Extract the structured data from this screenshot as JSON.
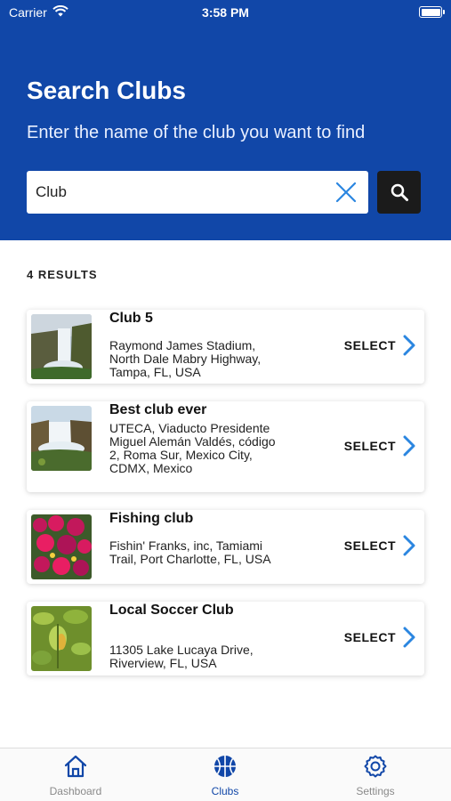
{
  "status": {
    "carrier": "Carrier",
    "time": "3:58 PM"
  },
  "header": {
    "title": "Search Clubs",
    "subtitle": "Enter the name of the club you want to find"
  },
  "search": {
    "value": "Club",
    "placeholder": ""
  },
  "results": {
    "count_label": "4 RESULTS",
    "items": [
      {
        "name": "Club 5",
        "address": "Raymond James Stadium, North Dale Mabry Highway, Tampa, FL, USA",
        "action": "SELECT",
        "image": "waterfall-photo"
      },
      {
        "name": "Best club ever",
        "address": "UTECA, Viaducto Presidente Miguel Alemán Valdés, código 2, Roma Sur, Mexico City, CDMX, Mexico",
        "action": "SELECT",
        "image": "waterfall-photo"
      },
      {
        "name": "Fishing club",
        "address": "Fishin' Franks, inc, Tamiami Trail, Port Charlotte, FL, USA",
        "action": "SELECT",
        "image": "flowers-photo"
      },
      {
        "name": "Local Soccer Club",
        "address": "11305 Lake Lucaya Drive, Riverview, FL, USA",
        "action": "SELECT",
        "image": "leaves-photo"
      }
    ]
  },
  "tabs": [
    {
      "label": "Dashboard",
      "icon": "home-icon"
    },
    {
      "label": "Clubs",
      "icon": "basketball-icon",
      "active": true
    },
    {
      "label": "Settings",
      "icon": "gear-icon"
    }
  ],
  "colors": {
    "brand": "#1147a8",
    "accent": "#2b86e0",
    "search_button": "#1b1b1b"
  }
}
